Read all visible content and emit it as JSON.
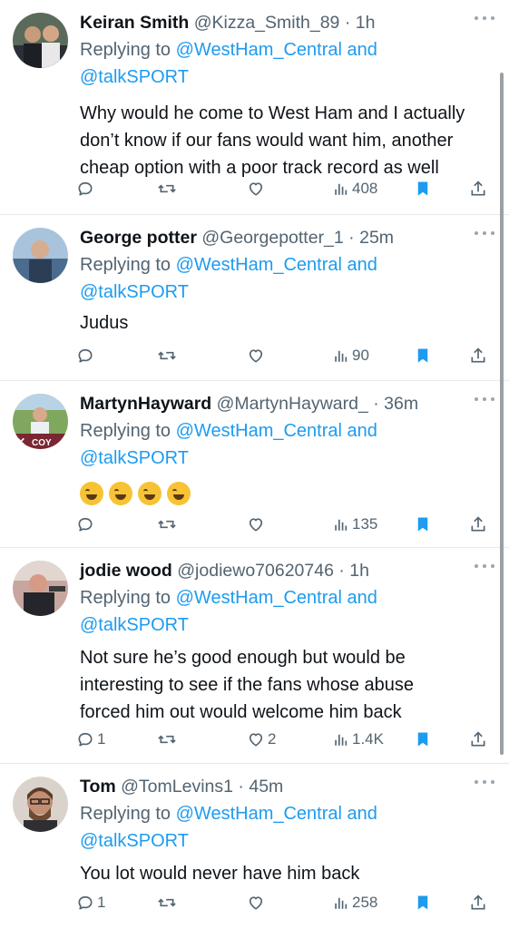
{
  "tweets": [
    {
      "name": "Keiran Smith",
      "handle": "@Kizza_Smith_89",
      "time": "1h",
      "replying_prefix": "Replying to ",
      "replying_to_1": "@WestHam_Central",
      "replying_and": " and",
      "replying_to_2": "@talkSPORT",
      "text": "Why would he come to West Ham and I actually\ndon’t know if our fans would want him, another\ncheap option with a poor track record as well",
      "replies": "",
      "retweets": "",
      "likes": "",
      "views": "408"
    },
    {
      "name": "George potter",
      "handle": "@Georgepotter_1",
      "time": "25m",
      "replying_prefix": "Replying to ",
      "replying_to_1": "@WestHam_Central",
      "replying_and": " and",
      "replying_to_2": "@talkSPORT",
      "text": "Judus",
      "replies": "",
      "retweets": "",
      "likes": "",
      "views": "90"
    },
    {
      "name": "MartynHayward",
      "handle": "@MartynHayward_",
      "time": "36m",
      "replying_prefix": "Replying to ",
      "replying_to_1": "@WestHam_Central",
      "replying_and": " and",
      "replying_to_2": "@talkSPORT",
      "text": "🤣🤣🤣🤣",
      "emoji_count": 4,
      "replies": "",
      "retweets": "",
      "likes": "",
      "views": "135",
      "avatar_badge": "COY"
    },
    {
      "name": "jodie wood",
      "handle": "@jodiewo70620746",
      "time": "1h",
      "replying_prefix": "Replying to ",
      "replying_to_1": "@WestHam_Central",
      "replying_and": " and",
      "replying_to_2": "@talkSPORT",
      "text": "Not sure he’s good enough but would be\ninteresting to see if the fans whose abuse\nforced him out would welcome him back",
      "replies": "1",
      "retweets": "",
      "likes": "2",
      "views": "1.4K"
    },
    {
      "name": "Tom",
      "handle": "@TomLevins1",
      "time": "45m",
      "replying_prefix": "Replying to ",
      "replying_to_1": "@WestHam_Central",
      "replying_and": " and",
      "replying_to_2": "@talkSPORT",
      "text": "You lot would never have him back",
      "replies": "1",
      "retweets": "",
      "likes": "",
      "views": "258"
    }
  ],
  "colors": {
    "link": "#1d9bf0",
    "muted": "#536471",
    "text": "#0f1419",
    "bookmark_active": "#1d9bf0"
  },
  "icons": {
    "reply": "reply-icon",
    "retweet": "retweet-icon",
    "like": "heart-icon",
    "views": "views-icon",
    "bookmark": "bookmark-icon",
    "share": "share-icon",
    "more": "more-icon"
  }
}
